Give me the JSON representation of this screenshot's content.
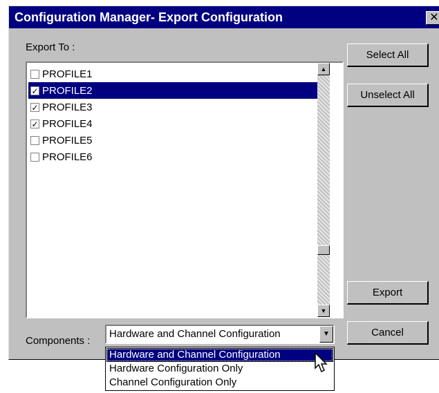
{
  "window": {
    "title": "Configuration Manager- Export Configuration",
    "close_glyph": "✕"
  },
  "export_to_label": "Export To :",
  "profiles": [
    {
      "label": "PROFILE1",
      "checked": false,
      "selected": false
    },
    {
      "label": "PROFILE2",
      "checked": true,
      "selected": true
    },
    {
      "label": "PROFILE3",
      "checked": true,
      "selected": false
    },
    {
      "label": "PROFILE4",
      "checked": true,
      "selected": false
    },
    {
      "label": "PROFILE5",
      "checked": false,
      "selected": false
    },
    {
      "label": "PROFILE6",
      "checked": false,
      "selected": false
    }
  ],
  "buttons": {
    "select_all": "Select All",
    "unselect_all": "Unselect All",
    "export": "Export",
    "cancel": "Cancel"
  },
  "components": {
    "label": "Components :",
    "selected_value": "Hardware and Channel Configuration",
    "options": [
      "Hardware and Channel Configuration",
      "Hardware Configuration Only",
      "Channel Configuration Only"
    ]
  },
  "icons": {
    "scroll_up": "up-arrow-icon",
    "scroll_down": "down-arrow-icon",
    "combo_arrow": "down-arrow-icon",
    "cursor": "mouse-pointer-icon"
  },
  "colors": {
    "selection": "#000080",
    "dialog_bg": "#c0c0c0"
  }
}
